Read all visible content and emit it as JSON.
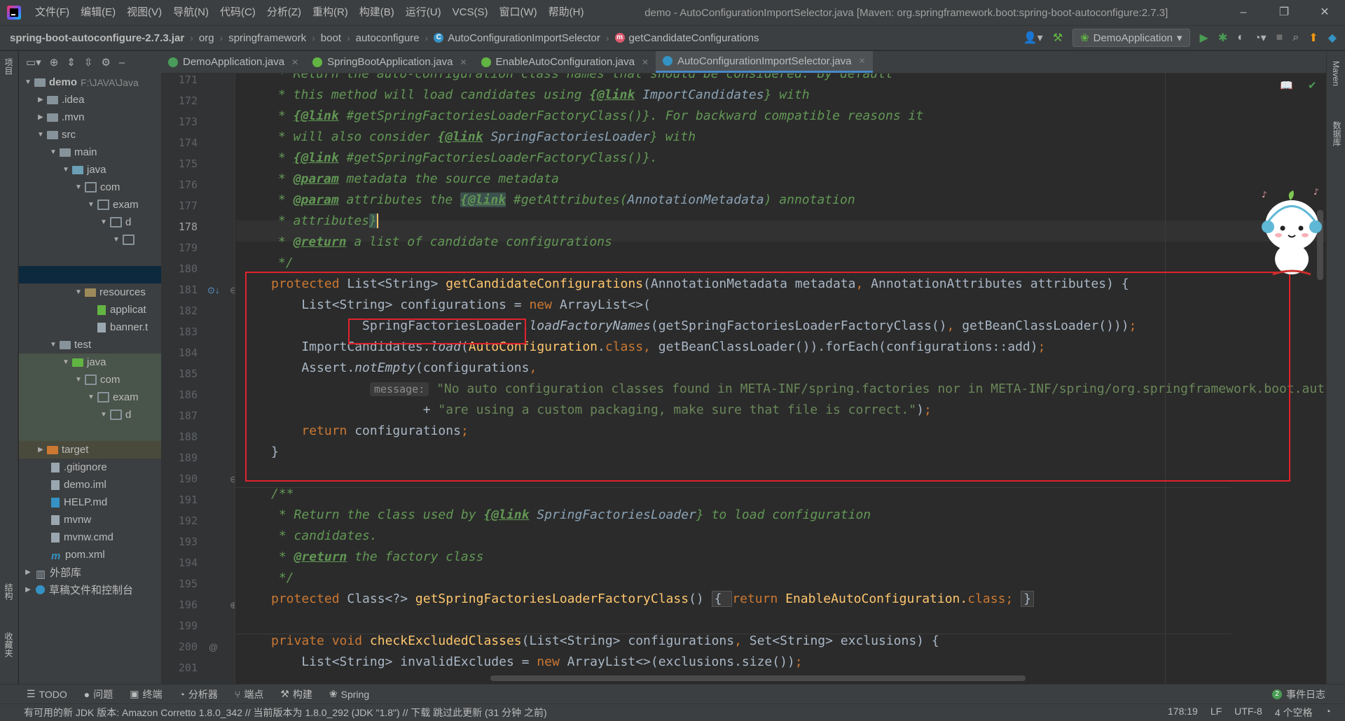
{
  "menubar": {
    "items": [
      "文件(F)",
      "编辑(E)",
      "视图(V)",
      "导航(N)",
      "代码(C)",
      "分析(Z)",
      "重构(R)",
      "构建(B)",
      "运行(U)",
      "VCS(S)",
      "窗口(W)",
      "帮助(H)"
    ],
    "title": "demo - AutoConfigurationImportSelector.java [Maven: org.springframework.boot:spring-boot-autoconfigure:2.7.3]",
    "minimize": "–",
    "restore": "❐",
    "close": "✕"
  },
  "breadcrumb": {
    "jar": "spring-boot-autoconfigure-2.7.3.jar",
    "parts": [
      "org",
      "springframework",
      "boot",
      "autoconfigure"
    ],
    "class": "AutoConfigurationImportSelector",
    "method": "getCandidateConfigurations",
    "run_config": "DemoApplication"
  },
  "left_strip": {
    "project": "项目",
    "structure": "结构",
    "favorites": "收藏夹"
  },
  "right_strip": {
    "maven": "Maven",
    "database": "数据库"
  },
  "project_tree": [
    {
      "label": "demo",
      "extra": "F:\\JAVA\\Java",
      "bold": true
    },
    {
      "label": ".idea"
    },
    {
      "label": ".mvn"
    },
    {
      "label": "src"
    },
    {
      "label": "main"
    },
    {
      "label": "java"
    },
    {
      "label": "com"
    },
    {
      "label": "exam"
    },
    {
      "label": "d"
    },
    {
      "label": ""
    },
    {
      "label": ""
    },
    {
      "label": "resources"
    },
    {
      "label": "applicat"
    },
    {
      "label": "banner.t"
    },
    {
      "label": "test"
    },
    {
      "label": "java"
    },
    {
      "label": "com"
    },
    {
      "label": "exam"
    },
    {
      "label": "d"
    },
    {
      "label": ""
    },
    {
      "label": "target"
    },
    {
      "label": ".gitignore"
    },
    {
      "label": "demo.iml"
    },
    {
      "label": "HELP.md"
    },
    {
      "label": "mvnw"
    },
    {
      "label": "mvnw.cmd"
    },
    {
      "label": "pom.xml"
    },
    {
      "label": "外部库"
    },
    {
      "label": "草稿文件和控制台"
    }
  ],
  "tabs": [
    {
      "label": "DemoApplication.java",
      "color": "#4a9c5a"
    },
    {
      "label": "SpringBootApplication.java",
      "color": "#62b543"
    },
    {
      "label": "EnableAutoConfiguration.java",
      "color": "#62b543"
    },
    {
      "label": "AutoConfigurationImportSelector.java",
      "color": "#3592c4"
    }
  ],
  "line_numbers": [
    "171",
    "172",
    "173",
    "174",
    "175",
    "176",
    "177",
    "178",
    "179",
    "180",
    "181",
    "182",
    "183",
    "184",
    "185",
    "186",
    "187",
    "188",
    "189",
    "190",
    "191",
    "192",
    "193",
    "194",
    "195",
    "196",
    "199",
    "200",
    "201"
  ],
  "code": {
    "l171": "* Return the auto-configuration class names that should be considered. By default",
    "l172a": "* this method will load candidates using ",
    "l172b": "{@link",
    "l172c": " ImportCandidates",
    "l172d": "} with",
    "l173a": "* ",
    "l173b": "{@link",
    "l173c": " #getSpringFactoriesLoaderFactoryClass()",
    "l173d": "}. For backward compatible reasons it",
    "l174a": "* will also consider ",
    "l174b": "{@link",
    "l174c": " SpringFactoriesLoader",
    "l174d": "} with",
    "l175a": "* ",
    "l175b": "{@link",
    "l175c": " #getSpringFactoriesLoaderFactoryClass()",
    "l175d": "}.",
    "l176a": "* ",
    "l176b": "@param",
    "l176c": " metadata the source metadata",
    "l177a": "* ",
    "l177b": "@param",
    "l177c": " attributes the ",
    "l177d": "{@link",
    "l177e": " #getAttributes(",
    "l177f": "AnnotationMetadata",
    "l177g": ") annotation",
    "l178a": "* attributes",
    "l178b": "}",
    "l179a": "* ",
    "l179b": "@return",
    "l179c": " a list of candidate configurations",
    "l180": "*/",
    "l181a": "protected ",
    "l181b": "List<String> ",
    "l181c": "getCandidateConfigurations",
    "l181d": "(AnnotationMetadata metadata",
    "l181e": ", ",
    "l181f": "AnnotationAttributes attributes) {",
    "l182a": "    List<String> configurations = ",
    "l182b": "new ",
    "l182c": "ArrayList<>(",
    "l183a": "            SpringFactoriesLoader",
    "l183b": ".",
    "l183c": "loadFactoryNames",
    "l183d": "(getSpringFactoriesLoaderFactoryClass()",
    "l183e": ", ",
    "l183f": "getBeanClassLoader()))",
    "l183g": ";",
    "l184a": "    ImportCandidates.",
    "l184b": "load",
    "l184c": "(",
    "l184d": "AutoConfiguration",
    "l184e": ".",
    "l184f": "class",
    "l184g": ", ",
    "l184h": "getBeanClassLoader()).forEach(configurations::add)",
    "l184i": ";",
    "l185a": "    Assert.",
    "l185b": "notEmpty",
    "l185c": "(configurations",
    "l185d": ",",
    "l186hint": "message:",
    "l186str": " \"No auto configuration classes found in META-INF/spring.factories nor in META-INF/spring/org.springframework.boot.aut",
    "l187a": "                    + ",
    "l187b": "\"are using a custom packaging, make sure that file is correct.\"",
    "l187c": ")",
    "l187d": ";",
    "l188a": "    ",
    "l188b": "return ",
    "l188c": "configurations",
    "l188d": ";",
    "l189": "}",
    "l191": "/**",
    "l192a": " * Return the class used by ",
    "l192b": "{@link",
    "l192c": " SpringFactoriesLoader",
    "l192d": "} to load configuration",
    "l193": " * candidates.",
    "l194a": " * ",
    "l194b": "@return",
    "l194c": " the factory class",
    "l195": " */",
    "l196a": "protected ",
    "l196b": "Class<?> ",
    "l196c": "getSpringFactoriesLoaderFactoryClass",
    "l196d": "() ",
    "l196e": "{ ",
    "l196f": "return ",
    "l196g": "EnableAutoConfiguration.",
    "l196h": "class",
    "l196i": "; ",
    "l196j": "}",
    "l200a": "private void ",
    "l200b": "checkExcludedClasses",
    "l200c": "(List<String> configurations",
    "l200d": ", ",
    "l200e": "Set<String> exclusions) {",
    "l201a": "    List<String> invalidExcludes = ",
    "l201b": "new ",
    "l201c": "ArrayList<>(exclusions.size())",
    "l201d": ";"
  },
  "toolwindows": [
    {
      "label": "TODO",
      "icon": "list-icon"
    },
    {
      "label": "问题",
      "icon": "info-icon"
    },
    {
      "label": "终端",
      "icon": "terminal-icon"
    },
    {
      "label": "分析器",
      "icon": "profiler-icon"
    },
    {
      "label": "端点",
      "icon": "endpoints-icon"
    },
    {
      "label": "构建",
      "icon": "hammer-icon"
    },
    {
      "label": "Spring",
      "icon": "spring-icon"
    }
  ],
  "event_log": {
    "count": "2",
    "label": "事件日志"
  },
  "status": {
    "message": "有可用的新 JDK 版本: Amazon Corretto 1.8.0_342 // 当前版本为 1.8.0_292 (JDK \"1.8\") // 下载   跳过此更新 (31 分钟 之前)",
    "position": "178:19",
    "line_sep": "LF",
    "encoding": "UTF-8",
    "indent": "4 个空格"
  },
  "colors": {
    "accent": "#4a88c7",
    "highlight_box": "#e0222b",
    "comment": "#629755",
    "keyword": "#cc7832",
    "function": "#ffc66d"
  }
}
